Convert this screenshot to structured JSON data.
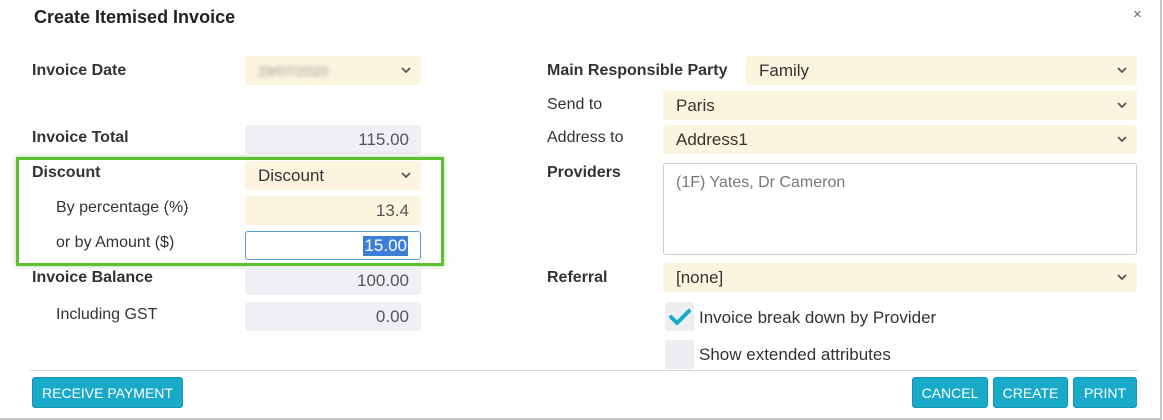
{
  "dialog": {
    "title": "Create Itemised Invoice",
    "close_label": "×"
  },
  "left": {
    "invoice_date_label": "Invoice Date",
    "invoice_date_value": "29/07/2020",
    "invoice_total_label": "Invoice Total",
    "invoice_total_value": "115.00",
    "discount_label": "Discount",
    "discount_value": "Discount",
    "by_percentage_label": "By percentage (%)",
    "by_percentage_value": "13.4",
    "by_amount_label": "or by Amount ($)",
    "by_amount_value": "15.00",
    "invoice_balance_label": "Invoice Balance",
    "invoice_balance_value": "100.00",
    "including_gst_label": "Including GST",
    "including_gst_value": "0.00"
  },
  "right": {
    "main_party_label": "Main Responsible Party",
    "main_party_value": "Family",
    "send_to_label": "Send to",
    "send_to_value": "Paris",
    "address_to_label": "Address to",
    "address_to_value": "Address1",
    "providers_label": "Providers",
    "providers_value": "(1F) Yates, Dr Cameron",
    "referral_label": "Referral",
    "referral_value": "[none]",
    "checkbox_breakdown_label": "Invoice break down by Provider",
    "checkbox_breakdown_checked": true,
    "checkbox_extended_label": "Show extended attributes",
    "checkbox_extended_checked": false
  },
  "footer": {
    "receive_payment": "RECEIVE PAYMENT",
    "cancel": "CANCEL",
    "create": "CREATE",
    "print": "PRINT"
  },
  "colors": {
    "accent": "#1aaac9",
    "field_bg": "#fdf4e0",
    "readonly_bg": "#eef0f4",
    "highlight_box": "#5cc12e",
    "check": "#1aaac9"
  }
}
